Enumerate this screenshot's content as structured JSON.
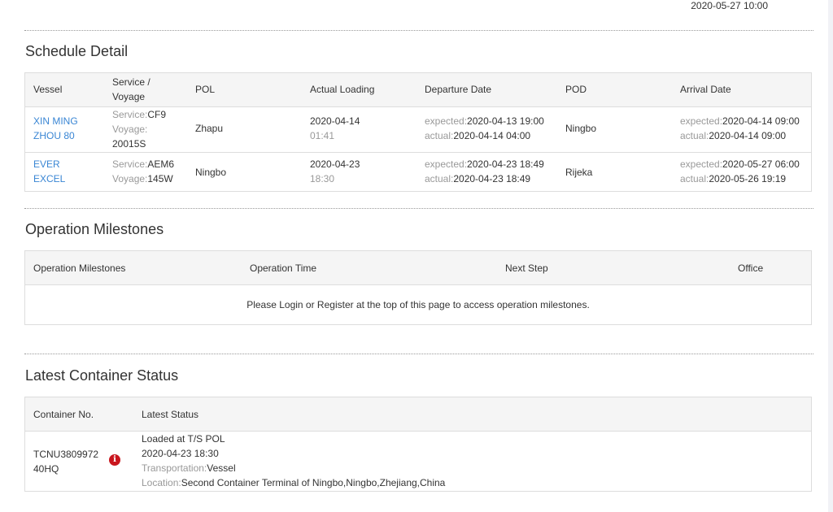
{
  "top_date": "2020-05-27 10:00",
  "schedule": {
    "title": "Schedule Detail",
    "headers": {
      "vessel": "Vessel",
      "service_voyage_1": "Service /",
      "service_voyage_2": "Voyage",
      "pol": "POL",
      "actual_loading": "Actual Loading",
      "departure": "Departure Date",
      "pod": "POD",
      "arrival": "Arrival Date"
    },
    "rows": [
      {
        "vessel_1": "XIN MING",
        "vessel_2": "ZHOU 80",
        "service_label": "Service:",
        "service": "CF9",
        "voyage_label": "Voyage:",
        "voyage": "20015S",
        "pol": "Zhapu",
        "loading_date": "2020-04-14",
        "loading_time": "01:41",
        "dep_expected_label": "expected:",
        "dep_expected": "2020-04-13 19:00",
        "dep_actual_label": "actual:",
        "dep_actual": "2020-04-14 04:00",
        "pod": "Ningbo",
        "arr_expected_label": "expected:",
        "arr_expected": "2020-04-14 09:00",
        "arr_actual_label": "actual:",
        "arr_actual": "2020-04-14 09:00"
      },
      {
        "vessel_1": "EVER",
        "vessel_2": "EXCEL",
        "service_label": "Service:",
        "service": "AEM6",
        "voyage_label": "Voyage:",
        "voyage": "145W",
        "pol": "Ningbo",
        "loading_date": "2020-04-23",
        "loading_time": "18:30",
        "dep_expected_label": "expected:",
        "dep_expected": "2020-04-23 18:49",
        "dep_actual_label": "actual:",
        "dep_actual": "2020-04-23 18:49",
        "pod": "Rijeka",
        "arr_expected_label": "expected:",
        "arr_expected": "2020-05-27 06:00",
        "arr_actual_label": "actual:",
        "arr_actual": "2020-05-26 19:19"
      }
    ]
  },
  "milestones": {
    "title": "Operation Milestones",
    "headers": {
      "milestones": "Operation Milestones",
      "time": "Operation Time",
      "next": "Next Step",
      "office": "Office"
    },
    "message": "Please Login or Register at the top of this page to access operation milestones."
  },
  "container": {
    "title": "Latest Container Status",
    "headers": {
      "number": "Container No.",
      "status": "Latest Status"
    },
    "row": {
      "number": "TCNU3809972",
      "size": "40HQ",
      "status": "Loaded at T/S POL",
      "datetime": "2020-04-23 18:30",
      "transport_label": "Transportation:",
      "transport": "Vessel",
      "location_label": "Location:",
      "location": "Second Container Terminal of Ningbo,Ningbo,Zhejiang,China"
    },
    "info_icon_color": "#c9161e"
  },
  "colors": {
    "link": "#3a86d4",
    "muted": "#999999"
  }
}
